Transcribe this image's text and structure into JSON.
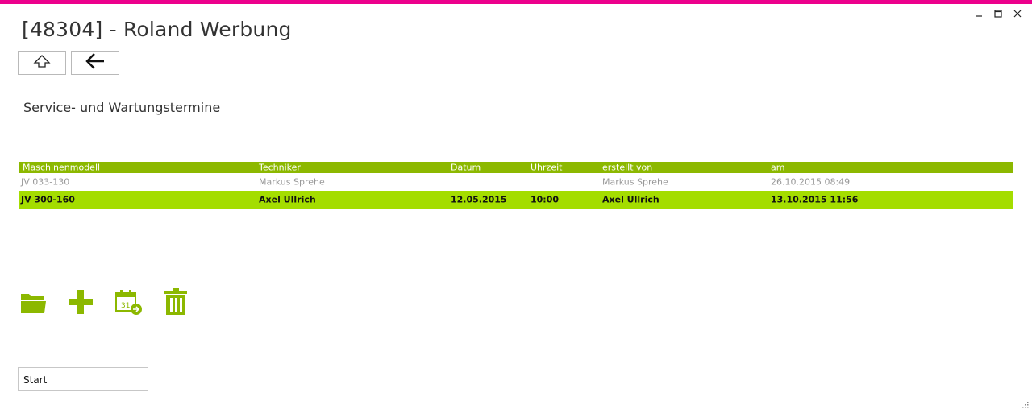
{
  "window": {
    "title": "[48304] - Roland Werbung",
    "accent_color": "#ec008c",
    "controls": [
      "minimize-icon",
      "maximize-icon",
      "close-icon"
    ]
  },
  "nav": {
    "home_icon": "up-arrow-icon",
    "back_icon": "back-arrow-icon"
  },
  "section": {
    "title": "Service- und Wartungstermine"
  },
  "table": {
    "header_color": "#8cb800",
    "selected_color": "#a4dd00",
    "columns": [
      "Maschinenmodell",
      "Techniker",
      "Datum",
      "Uhrzeit",
      "erstellt von",
      "am"
    ],
    "rows": [
      [
        "JV 033-130",
        "Markus Sprehe",
        "",
        "",
        "Markus Sprehe",
        "26.10.2015 08:49"
      ],
      [
        "JV 300-160",
        "Axel Ullrich",
        "12.05.2015",
        "10:00",
        "Axel Ullrich",
        "13.10.2015 11:56"
      ]
    ],
    "selected_row": 1
  },
  "actions": {
    "icons": [
      "open-folder-icon",
      "add-icon",
      "calendar-forward-icon",
      "delete-icon"
    ],
    "calendar_day": "31",
    "icon_color": "#8cb800"
  },
  "start": {
    "label": "Start"
  }
}
